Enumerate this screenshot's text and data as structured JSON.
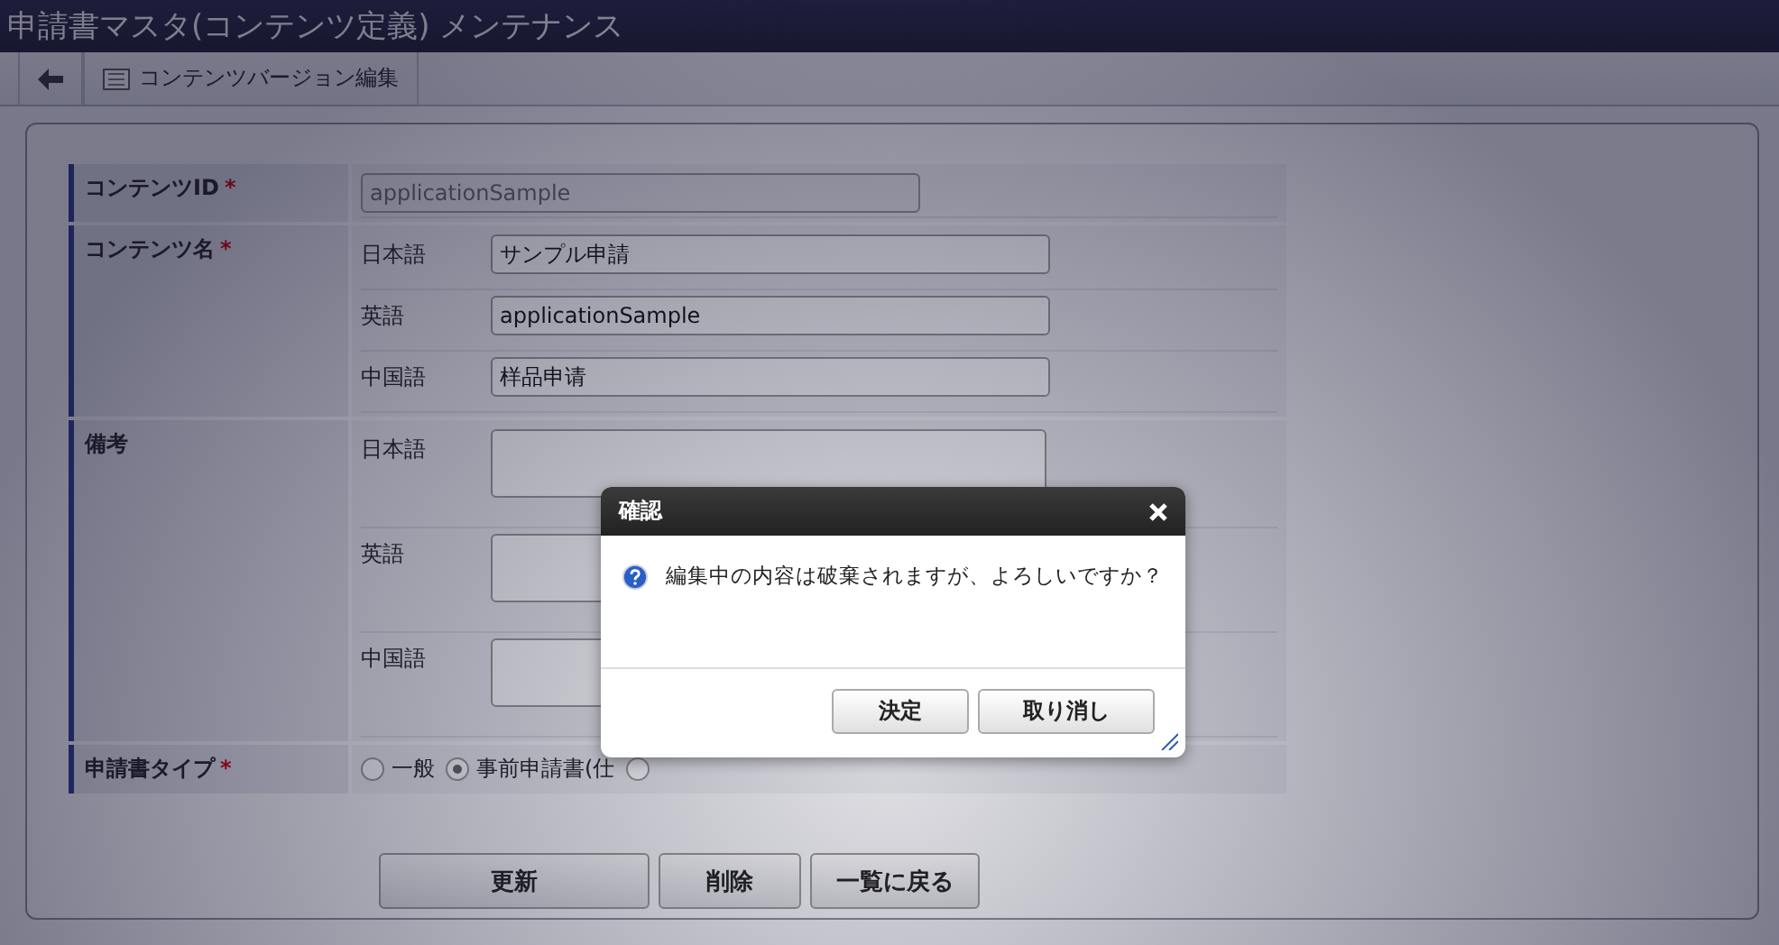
{
  "window": {
    "title": "申請書マスタ(コンテンツ定義) メンテナンス"
  },
  "toolbar": {
    "tab": "コンテンツバージョン編集"
  },
  "form": {
    "rows": [
      {
        "kind": "single",
        "label": "コンテンツID",
        "required_mark": "*",
        "value": "applicationSample",
        "disabled": true
      },
      {
        "kind": "langs",
        "label": "コンテンツ名",
        "required_mark": "*",
        "fields": [
          {
            "lang": "日本語",
            "value": "サンプル申請"
          },
          {
            "lang": "英語",
            "value": "applicationSample"
          },
          {
            "lang": "中国語",
            "value": "样品申请"
          }
        ]
      },
      {
        "kind": "areas",
        "label": "備考",
        "fields": [
          {
            "lang": "日本語"
          },
          {
            "lang": "英語"
          },
          {
            "lang": "中国語"
          }
        ]
      },
      {
        "kind": "radios",
        "label": "申請書タイプ",
        "required_mark": "*",
        "options": [
          {
            "label": "一般",
            "selected": false
          },
          {
            "label": "事前申請書(仕",
            "selected": true
          },
          {
            "selected": false
          }
        ]
      }
    ]
  },
  "buttons": [
    "更新",
    "削除",
    "一覧に戻る"
  ],
  "dialog": {
    "title": "確認",
    "message": "編集中の内容は破棄されますが、よろしいですか？",
    "buttons": [
      "決定",
      "取り消し"
    ]
  }
}
